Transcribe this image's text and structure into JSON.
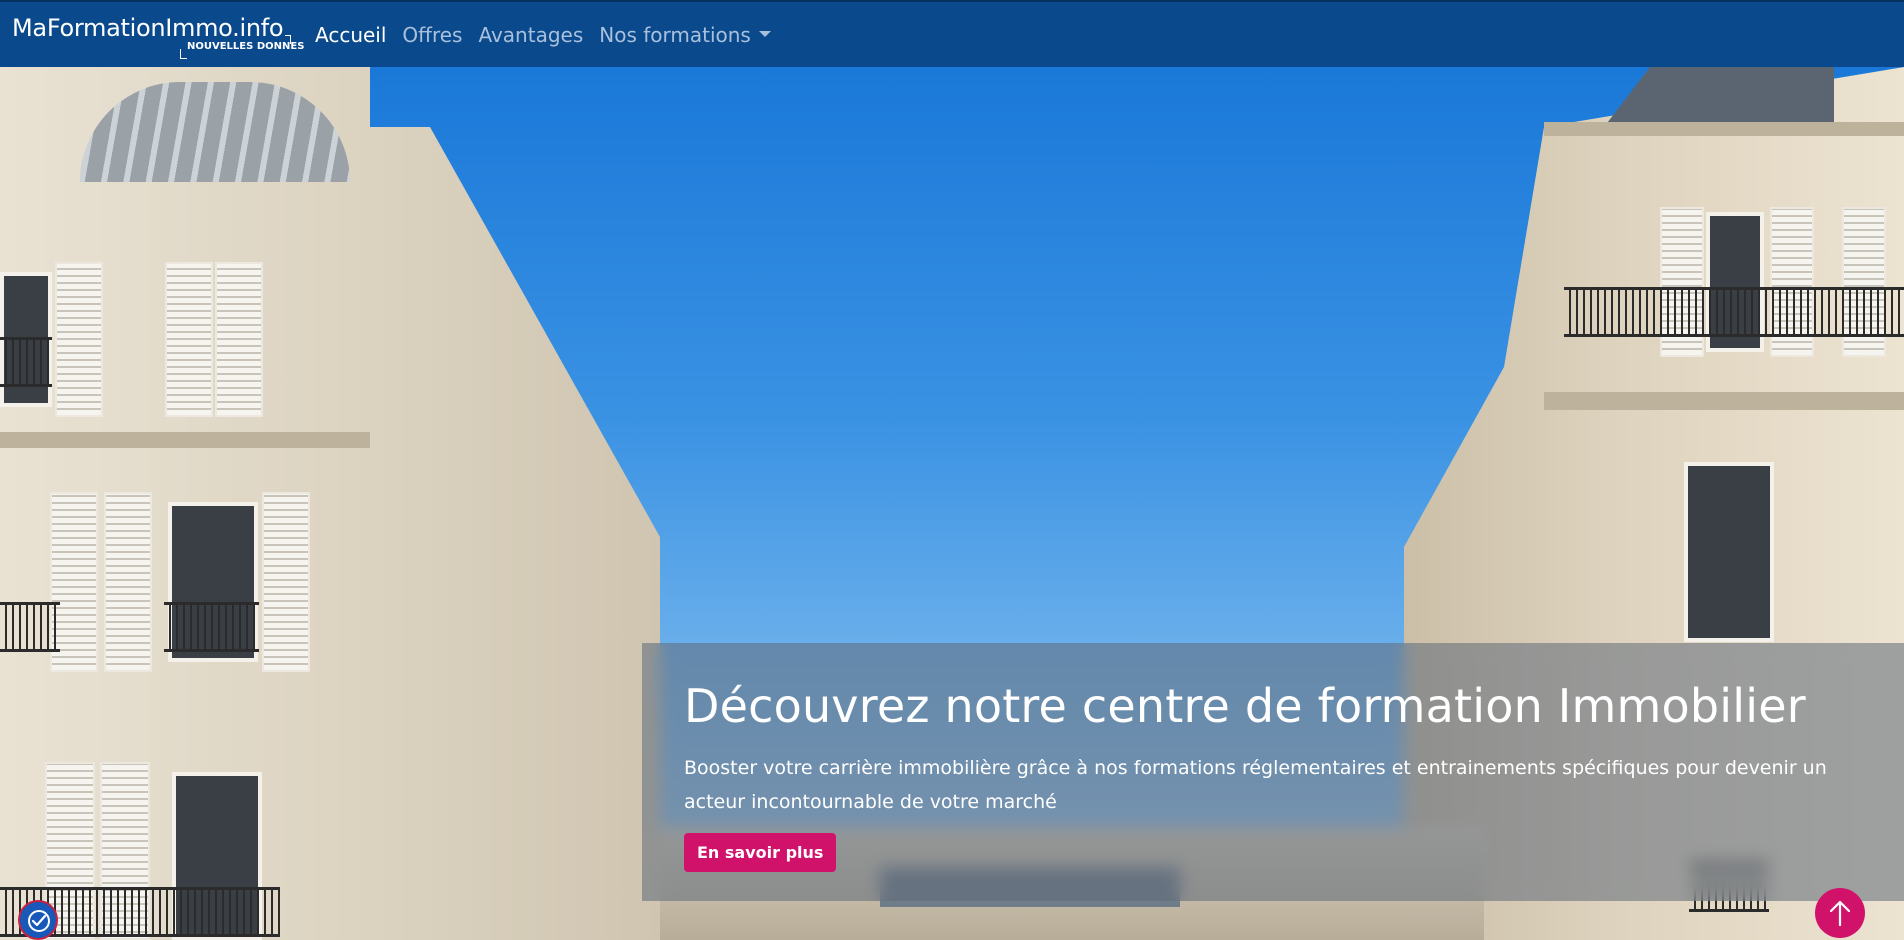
{
  "brand": {
    "name": "MaFormationImmo.info",
    "tagline": "NOUVELLES DONNES"
  },
  "nav": {
    "items": [
      {
        "label": "Accueil",
        "active": true
      },
      {
        "label": "Offres",
        "active": false
      },
      {
        "label": "Avantages",
        "active": false
      },
      {
        "label": "Nos formations",
        "active": false,
        "dropdown": true
      }
    ]
  },
  "hero": {
    "title": "Découvrez notre centre de formation Immobilier",
    "text": "Booster votre carrière immobilière grâce à nos formations réglementaires et entrainements spécifiques pour devenir un acteur incontournable de votre marché",
    "button_label": "En savoir plus"
  },
  "icons": {
    "cookie": "cookie-consent-icon",
    "back_to_top": "arrow-up-icon",
    "dropdown": "chevron-down-icon"
  },
  "colors": {
    "navbar": "#0a4a8c",
    "accent": "#d1126b",
    "nav_active": "#ffffff",
    "nav_inactive": "#a9c0dc"
  }
}
